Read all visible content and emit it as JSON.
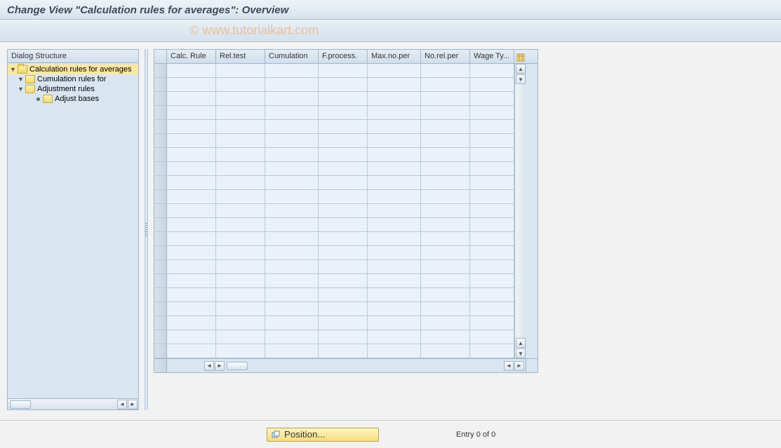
{
  "header": {
    "title": "Change View \"Calculation rules for averages\": Overview"
  },
  "watermark": "© www.tutorialkart.com",
  "tree": {
    "title": "Dialog Structure",
    "nodes": [
      {
        "label": "Calculation rules for averages",
        "level": 0,
        "selected": true,
        "expandable": true,
        "open": true
      },
      {
        "label": "Cumulation rules for",
        "level": 1,
        "selected": false,
        "expandable": true,
        "open": false
      },
      {
        "label": "Adjustment rules",
        "level": 1,
        "selected": false,
        "expandable": true,
        "open": false
      },
      {
        "label": "Adjust bases",
        "level": 2,
        "selected": false,
        "expandable": false,
        "open": false
      }
    ]
  },
  "grid": {
    "columns": [
      {
        "key": "calc",
        "label": "Calc. Rule"
      },
      {
        "key": "rel",
        "label": "Rel.test"
      },
      {
        "key": "cum",
        "label": "Cumulation"
      },
      {
        "key": "fproc",
        "label": "F.process."
      },
      {
        "key": "max",
        "label": "Max.no.per"
      },
      {
        "key": "norel",
        "label": "No.rel.per"
      },
      {
        "key": "wage",
        "label": "Wage Ty..."
      }
    ],
    "row_count": 21
  },
  "footer": {
    "position_label": "Position...",
    "entry_text": "Entry 0 of 0"
  }
}
